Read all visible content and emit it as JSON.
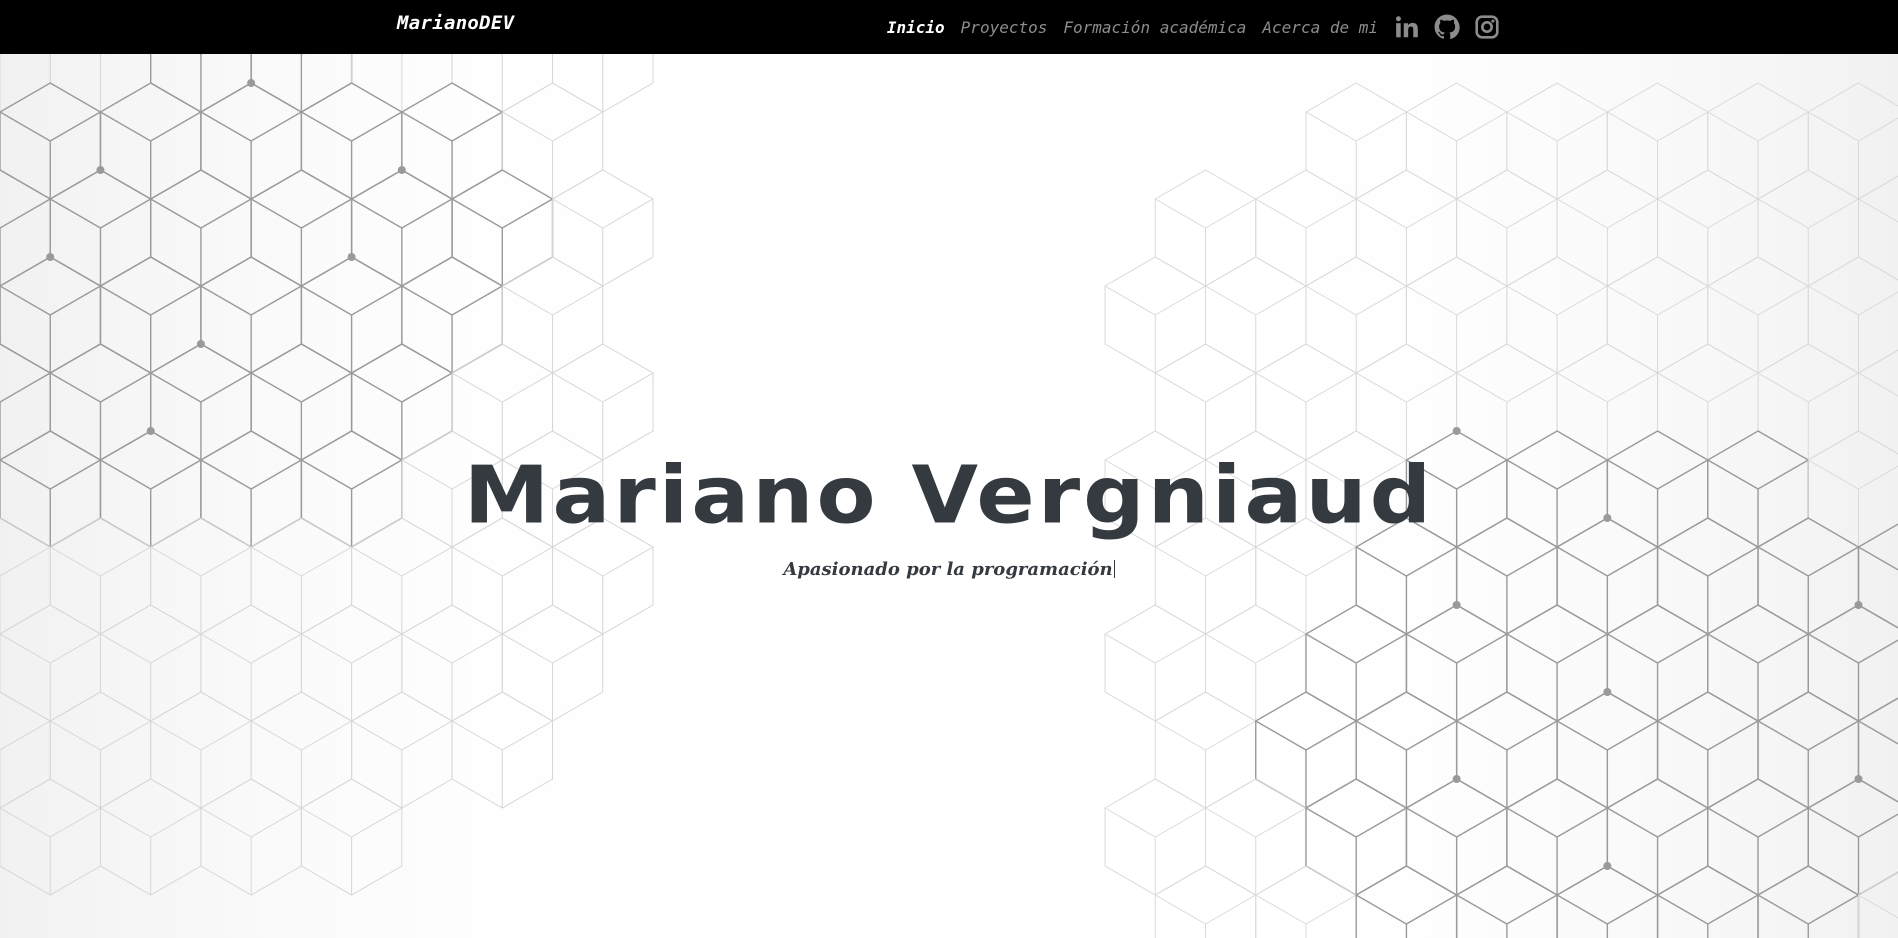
{
  "navbar": {
    "brand": "MarianoDEV",
    "links": [
      {
        "label": "Inicio",
        "active": true
      },
      {
        "label": "Proyectos",
        "active": false
      },
      {
        "label": "Formación académica",
        "active": false
      },
      {
        "label": "Acerca de mi",
        "active": false
      }
    ],
    "social_icons": [
      "linkedin-icon",
      "github-icon",
      "instagram-icon"
    ]
  },
  "hero": {
    "name": "Mariano Vergniaud",
    "tagline": "Apasionado por la programación"
  },
  "colors": {
    "navbar_bg": "#000000",
    "nav_active": "#ffffff",
    "nav_inactive": "#8c8c8c",
    "hero_text": "#343a40",
    "pattern_line": "#9a9a9a"
  }
}
